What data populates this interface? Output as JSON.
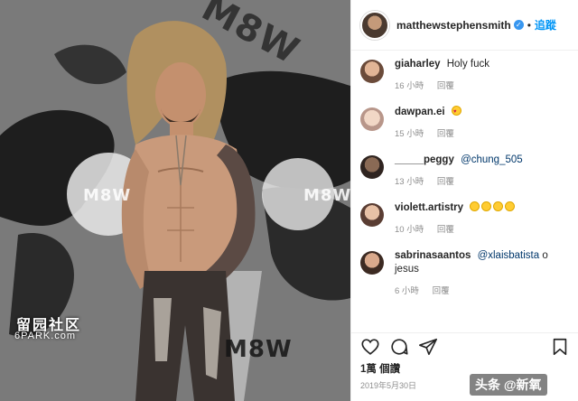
{
  "post": {
    "username": "matthewstephensmith",
    "verified": true,
    "follow_label": "追蹤",
    "likes": "1萬 個讚",
    "date": "2019年5月30日"
  },
  "photo": {
    "watermarks": [
      "M8W",
      "M8W",
      "M8W",
      "M8W"
    ],
    "forum_mark": "留园社区",
    "site_mark": "6PARK.com",
    "main_colors": [
      "#6f6f6f",
      "#1a1a1a",
      "#c99a7b"
    ]
  },
  "comments": [
    {
      "user": "giaharley",
      "text": "Holy fuck",
      "mention": "",
      "emojis": [],
      "time": "16 小時",
      "reply": "回覆"
    },
    {
      "user": "dawpan.ei",
      "text": "",
      "mention": "",
      "emojis": [
        "heart-eyes"
      ],
      "time": "15 小時",
      "reply": "回覆"
    },
    {
      "user": "_____peggy",
      "text": "",
      "mention": "@chung_505",
      "emojis": [],
      "time": "13 小時",
      "reply": "回覆"
    },
    {
      "user": "violett.artistry",
      "text": "",
      "mention": "",
      "emojis": [
        "grin",
        "grin",
        "grin",
        "grin"
      ],
      "time": "10 小時",
      "reply": "回覆"
    },
    {
      "user": "sabrinasaantos",
      "text": "o jesus",
      "mention": "@xlaisbatista",
      "emojis": [],
      "time": "6 小時",
      "reply": "回覆"
    }
  ],
  "icons": [
    "heart-icon",
    "comment-icon",
    "share-icon",
    "bookmark-icon"
  ],
  "overlay": {
    "toutiao_mark": "头条 @新氧"
  }
}
